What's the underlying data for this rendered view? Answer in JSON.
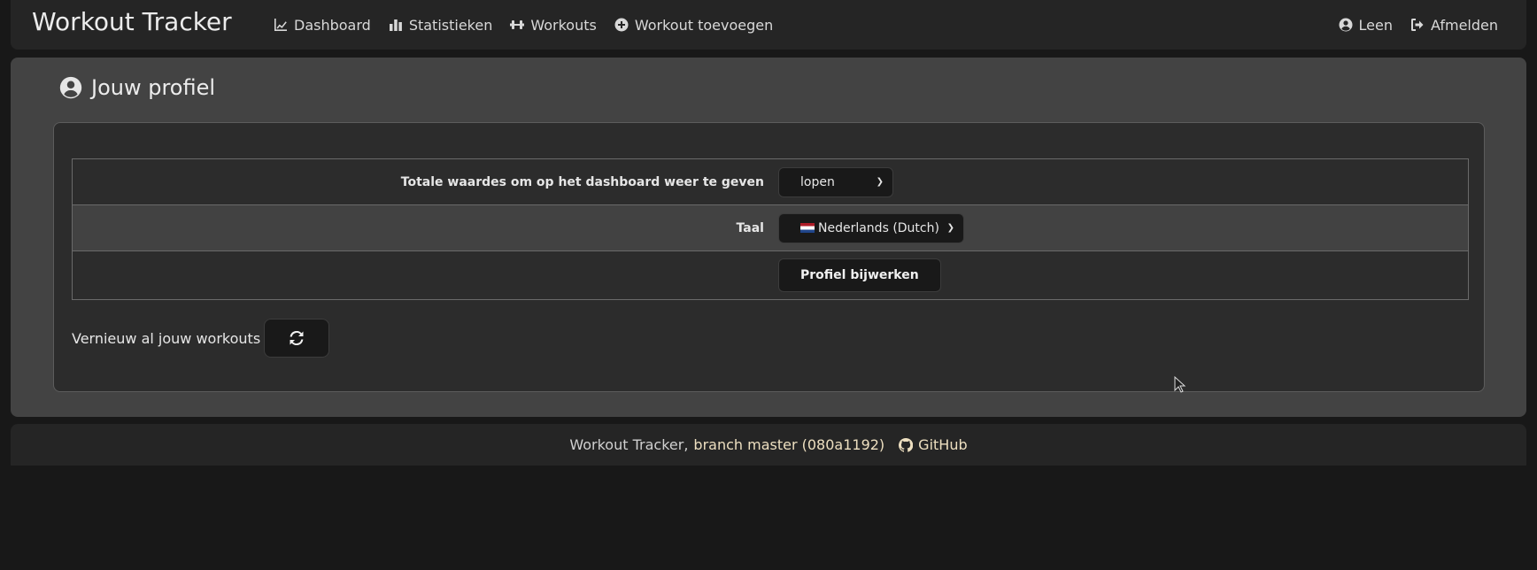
{
  "app": {
    "title": "Workout Tracker"
  },
  "nav": {
    "items": [
      {
        "label": "Dashboard",
        "icon": "chart-line-icon"
      },
      {
        "label": "Statistieken",
        "icon": "chart-bar-icon"
      },
      {
        "label": "Workouts",
        "icon": "dumbbell-icon"
      },
      {
        "label": "Workout toevoegen",
        "icon": "circle-plus-icon"
      }
    ],
    "user": {
      "label": "Leen",
      "icon": "user-circle-icon"
    },
    "logout": {
      "label": "Afmelden",
      "icon": "sign-out-icon"
    }
  },
  "profile": {
    "title": "Jouw profiel",
    "icon": "user-circle-icon",
    "rows": [
      {
        "label": "Totale waardes om op het dashboard weer te geven",
        "value": "lopen"
      },
      {
        "label": "Taal",
        "value": "Nederlands (Dutch)",
        "flag": "nl-flag"
      }
    ],
    "update_button": "Profiel bijwerken",
    "refresh_label": "Vernieuw al jouw workouts",
    "refresh_icon": "refresh-icon"
  },
  "footer": {
    "prefix": "Workout Tracker,",
    "branch": "branch master (080a1192)",
    "github": "GitHub",
    "github_icon": "github-icon"
  }
}
